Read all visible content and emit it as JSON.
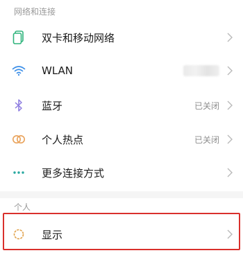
{
  "sections": {
    "network_header": "网络和连接",
    "personal_header": "个人"
  },
  "rows": {
    "dual_sim": {
      "label": "双卡和移动网络",
      "icon": "sim-card-icon"
    },
    "wlan": {
      "label": "WLAN",
      "icon": "wifi-icon"
    },
    "bluetooth": {
      "label": "蓝牙",
      "value": "已关闭",
      "icon": "bluetooth-icon"
    },
    "hotspot": {
      "label": "个人热点",
      "value": "已关闭",
      "icon": "hotspot-icon"
    },
    "more": {
      "label": "更多连接方式",
      "icon": "more-dots-icon"
    },
    "display": {
      "label": "显示",
      "icon": "display-sun-icon"
    }
  },
  "colors": {
    "accent": "#2fb47c",
    "icon_blue": "#3b8ee8",
    "icon_purple": "#8c7be0",
    "icon_orange": "#e9a25a",
    "icon_teal": "#28a8a0",
    "display_icon": "#e0a048",
    "highlight": "#d9302c"
  }
}
